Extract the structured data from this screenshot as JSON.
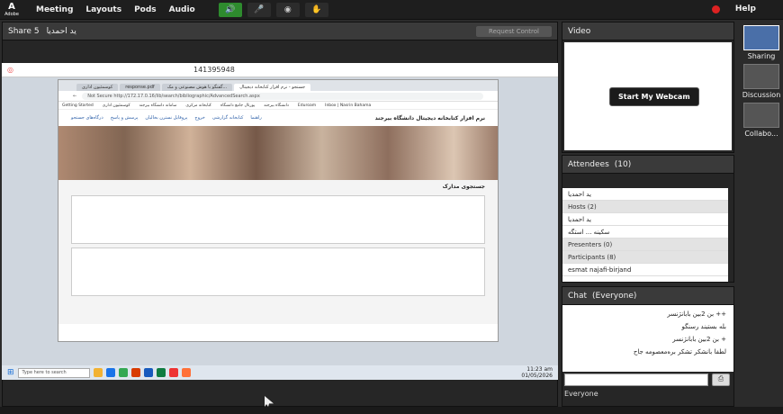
{
  "topbar": {
    "brand": "Adobe",
    "menus": [
      "Meeting",
      "Layouts",
      "Pods",
      "Audio"
    ],
    "help": "Help"
  },
  "share": {
    "title": "Share 5",
    "presenter": "ید احمدیا",
    "request_label": "Request Control"
  },
  "remote": {
    "session_id": "141395948"
  },
  "browser": {
    "tabs": [
      "کوسمئیون اداری",
      "response.pdf",
      "گفتگو با هوش مصنوعی و مک...",
      "جستجو - نرم افزار کتابخانه دیجیتال"
    ],
    "url": "Not Secure  http://172.17.0.16/lib/search/bibliographic/AdvancedSearch.aspx",
    "bookmarks": [
      "Getting Started",
      "کوسمئیون اداری",
      "سامانه دانشگاه بیرجند",
      "کتابخانه مرکزی",
      "پورتال جامع دانشگاه",
      "دانشگاه بیرجند",
      "Eduroam",
      "Inbox | Nasrin Bahama"
    ],
    "site_title": "نرم افزار کتابخانه دیجیتال دانشگاه بیرجند",
    "site_nav": [
      "درگاه‌های جستجو",
      "پرسش و پاسخ",
      "پروفایل نسترن بخالیان",
      "خروج",
      "کتابخانه گزارشی",
      "راهنما"
    ],
    "section": "جستجوی مدارک"
  },
  "desktop": {
    "taskbar_search": "Type here to search",
    "time": "11:23 am",
    "date": "01/05/2026"
  },
  "video": {
    "title": "Video",
    "webcam_label": "Start My Webcam"
  },
  "attendees": {
    "title": "Attendees",
    "count": "(10)",
    "me": "ید احمدیا",
    "hosts": "Hosts (2)",
    "host1": "ید احمدیا",
    "host2": "سکینه ... استگه",
    "presenters": "Presenters (0)",
    "participants": "Participants (8)",
    "p1": "esmat najafi-birjand"
  },
  "chat": {
    "title": "Chat",
    "scope": "(Everyone)",
    "lines": [
      "++ بن 2بین بابانژنسر",
      "بله بستیند رسنگو",
      "+ بن 2بین بابانژنسر",
      "لطفا بانشکر تشکر بره‌معصومه جاح"
    ],
    "footer": "Everyone",
    "send": "⎙"
  },
  "layouts": [
    {
      "label": "Sharing"
    },
    {
      "label": "Discussion"
    },
    {
      "label": "Collabo..."
    }
  ]
}
